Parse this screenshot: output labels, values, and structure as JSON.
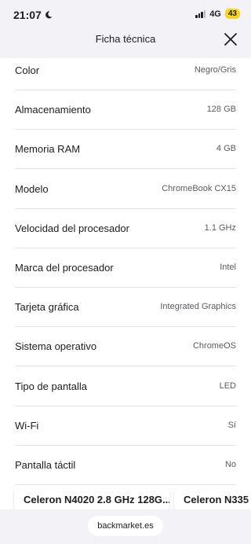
{
  "status_bar": {
    "time": "21:07",
    "network": "4G",
    "battery": "43"
  },
  "header": {
    "title": "Ficha técnica"
  },
  "specs": [
    {
      "label": "Color",
      "value": "Negro/Gris"
    },
    {
      "label": "Almacenamiento",
      "value": "128 GB"
    },
    {
      "label": "Memoria RAM",
      "value": "4 GB"
    },
    {
      "label": "Modelo",
      "value": "ChromeBook CX15"
    },
    {
      "label": "Velocidad del procesador",
      "value": "1.1 GHz"
    },
    {
      "label": "Marca del procesador",
      "value": "Intel"
    },
    {
      "label": "Tarjeta gráfica",
      "value": "Integrated Graphics"
    },
    {
      "label": "Sistema operativo",
      "value": "ChromeOS"
    },
    {
      "label": "Tipo de pantalla",
      "value": "LED"
    },
    {
      "label": "Wi-Fi",
      "value": "Sí"
    },
    {
      "label": "Pantalla táctil",
      "value": "No"
    }
  ],
  "carousel": [
    {
      "label": "Celeron N4020 2.8 GHz 128G..."
    },
    {
      "label": "Celeron N335"
    }
  ],
  "browser": {
    "url": "backmarket.es"
  }
}
